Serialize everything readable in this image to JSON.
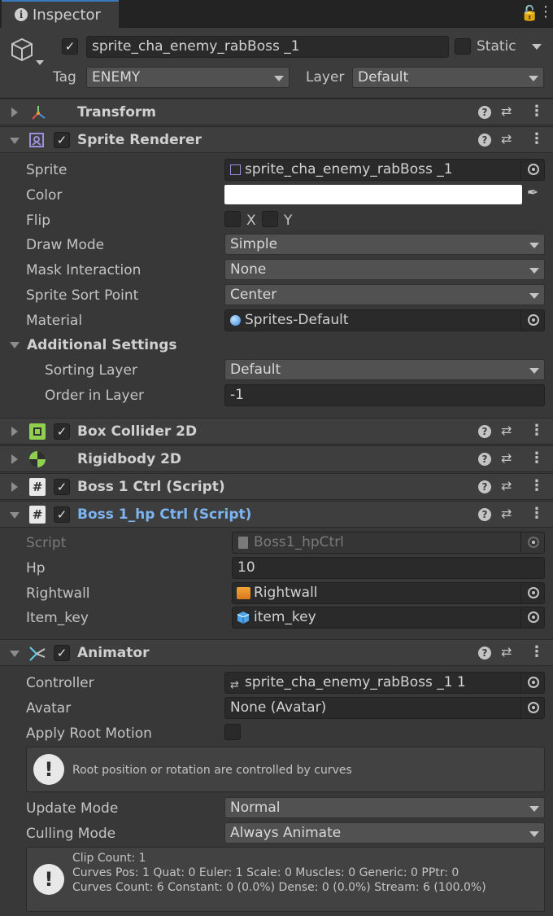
{
  "tab": {
    "label": "Inspector"
  },
  "header": {
    "object_name": "sprite_cha_enemy_rabBoss _1",
    "static_label": "Static",
    "tag_label": "Tag",
    "tag_value": "ENEMY",
    "layer_label": "Layer",
    "layer_value": "Default"
  },
  "transform": {
    "title": "Transform"
  },
  "sprite_renderer": {
    "title": "Sprite Renderer",
    "sprite_label": "Sprite",
    "sprite_value": "sprite_cha_enemy_rabBoss _1",
    "color_label": "Color",
    "color_value": "#FFFFFF",
    "flip_label": "Flip",
    "flip_x": "X",
    "flip_y": "Y",
    "draw_mode_label": "Draw Mode",
    "draw_mode_value": "Simple",
    "mask_label": "Mask Interaction",
    "mask_value": "None",
    "sort_point_label": "Sprite Sort Point",
    "sort_point_value": "Center",
    "material_label": "Material",
    "material_value": "Sprites-Default",
    "additional_label": "Additional Settings",
    "sorting_layer_label": "Sorting Layer",
    "sorting_layer_value": "Default",
    "order_label": "Order in Layer",
    "order_value": "-1"
  },
  "box_collider": {
    "title": "Box Collider 2D"
  },
  "rigidbody": {
    "title": "Rigidbody 2D"
  },
  "boss_ctrl": {
    "title": "Boss 1 Ctrl (Script)"
  },
  "boss_hp": {
    "title": "Boss 1_hp Ctrl (Script)",
    "script_label": "Script",
    "script_value": "Boss1_hpCtrl",
    "hp_label": "Hp",
    "hp_value": "10",
    "rightwall_label": "Rightwall",
    "rightwall_value": "Rightwall",
    "item_key_label": "Item_key",
    "item_key_value": "item_key"
  },
  "animator": {
    "title": "Animator",
    "controller_label": "Controller",
    "controller_value": "sprite_cha_enemy_rabBoss _1 1",
    "avatar_label": "Avatar",
    "avatar_value": "None (Avatar)",
    "root_motion_label": "Apply Root Motion",
    "curves_msg": "Root position or rotation are controlled by curves",
    "update_mode_label": "Update Mode",
    "update_mode_value": "Normal",
    "culling_label": "Culling Mode",
    "culling_value": "Always Animate",
    "info_line1": "Clip Count: 1",
    "info_line2": "Curves Pos: 1 Quat: 0 Euler: 1 Scale: 0 Muscles: 0 Generic: 0 PPtr: 0",
    "info_line3": "Curves Count: 6 Constant: 0 (0.0%) Dense: 0 (0.0%) Stream: 6 (100.0%)"
  },
  "colors": {
    "accent": "#3a79bb",
    "script_title": "#7bb4f0",
    "box_collider_icon": "#8fd14f",
    "rigidbody_icon": "#8fd14f"
  }
}
